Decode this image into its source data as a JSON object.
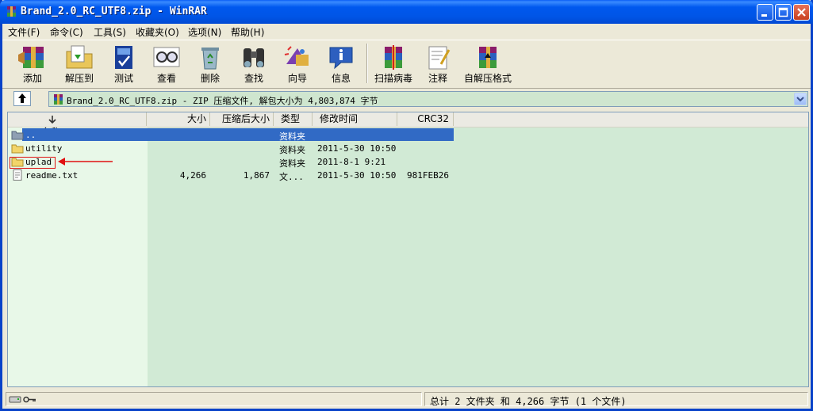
{
  "window": {
    "title": "Brand_2.0_RC_UTF8.zip - WinRAR"
  },
  "menu": [
    "文件(F)",
    "命令(C)",
    "工具(S)",
    "收藏夹(O)",
    "选项(N)",
    "帮助(H)"
  ],
  "toolbar": [
    "添加",
    "解压到",
    "测试",
    "查看",
    "删除",
    "查找",
    "向导",
    "信息",
    "扫描病毒",
    "注释",
    "自解压格式"
  ],
  "address": {
    "text": "Brand_2.0_RC_UTF8.zip - ZIP 压缩文件, 解包大小为 4,803,874 字节"
  },
  "columns": {
    "name": "名称",
    "size": "大小",
    "packed": "压缩后大小",
    "type": "类型",
    "modified": "修改时间",
    "crc": "CRC32"
  },
  "files": [
    {
      "name": "..",
      "size": "",
      "packed": "",
      "type": "资料夹",
      "modified": "",
      "crc": "",
      "icon": "folder-up-icon",
      "selected": true
    },
    {
      "name": "utility",
      "size": "",
      "packed": "",
      "type": "资料夹",
      "modified": "2011-5-30 10:50",
      "crc": "",
      "icon": "folder-icon",
      "selected": false
    },
    {
      "name": "uplad",
      "size": "",
      "packed": "",
      "type": "资料夹",
      "modified": "2011-8-1 9:21",
      "crc": "",
      "icon": "folder-icon",
      "selected": false
    },
    {
      "name": "readme.txt",
      "size": "4,266",
      "packed": "1,867",
      "type": "文...",
      "modified": "2011-5-30 10:50",
      "crc": "981FEB26",
      "icon": "text-file-icon",
      "selected": false
    }
  ],
  "status": {
    "summary": "总计 2 文件夹 和 4,266 字节 (1 个文件)"
  },
  "colors": {
    "title_bar": "#0058ee",
    "list_bg": "#d1ead5",
    "selection": "#316ac5",
    "annotation": "#e01010"
  }
}
